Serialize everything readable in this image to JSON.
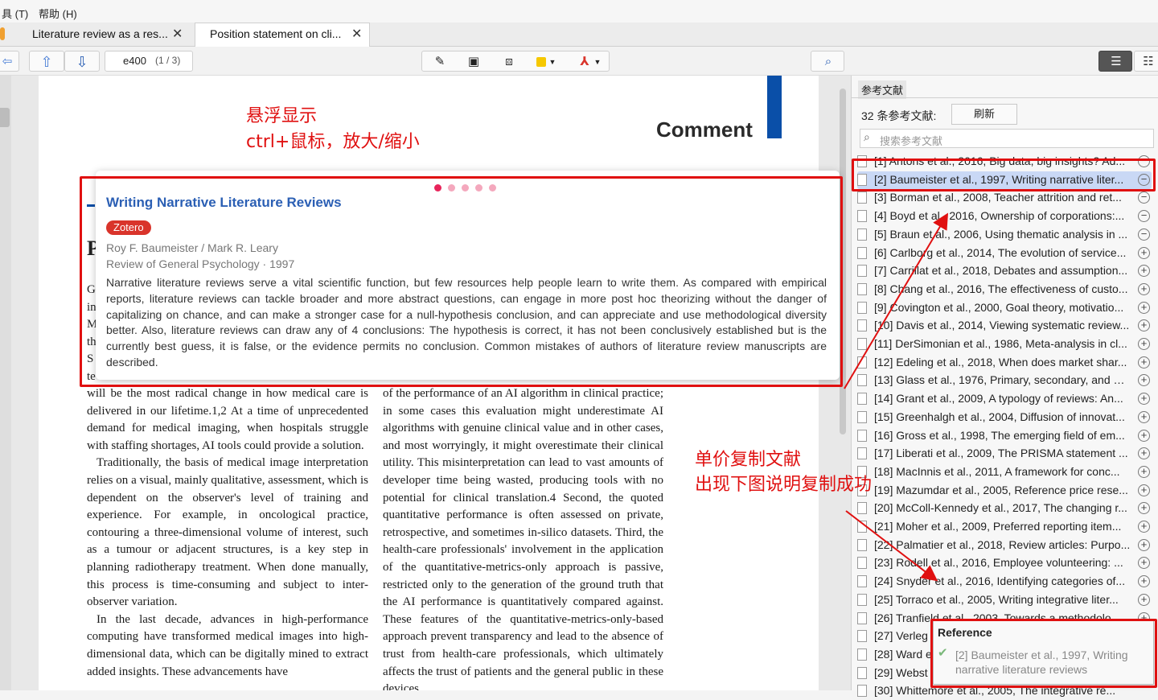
{
  "menu": {
    "tools": "具 (T)",
    "help": "帮助 (H)"
  },
  "tabs": [
    {
      "label": "Literature review as a res..."
    },
    {
      "label": "Position statement on cli..."
    }
  ],
  "toolbar": {
    "page_input": "e400",
    "page_count": "(1 / 3)"
  },
  "page": {
    "comment_heading": "Comment",
    "fragment_letters": [
      "P",
      "G",
      "in",
      "M",
      "th",
      "S",
      "te"
    ],
    "left_column": [
      "will be the most radical change in how medical care is delivered in our lifetime.1,2 At a time of unprecedented demand for medical imaging, when hospitals struggle with staffing shortages, AI tools could provide a solution.",
      "Traditionally, the basis of medical image interpretation relies on a visual, mainly qualitative, assessment, which is dependent on the observer's level of training and experience. For example, in oncological practice, contouring a three-dimensional volume of interest, such as a tumour or adjacent structures, is a key step in planning radiotherapy treatment. When done manually, this process is time-consuming and subject to inter-observer variation.",
      "In the last decade, advances in high-performance computing have transformed medical images into high-dimensional data, which can be digitally mined to extract added insights. These advancements have"
    ],
    "right_column": [
      "of the performance of an AI algorithm in clinical practice; in some cases this evaluation might underestimate AI algorithms with genuine clinical value and in other cases, and most worryingly, it might overestimate their clinical utility. This misinterpretation can lead to vast amounts of developer time being wasted, producing tools with no potential for clinical translation.4 Second, the quoted quantitative performance is often assessed on private, retrospective, and sometimes in-silico datasets. Third, the health-care professionals' involvement in the application of the quantitative-metrics-only approach is passive, restricted only to the generation of the ground truth that the AI performance is quantitatively compared against. These features of the quantitative-metrics-only-based approach prevent transparency and lead to the absence of trust from health-care professionals, which ultimately affects the trust of patients and the general public in these devices."
    ]
  },
  "popup": {
    "title": "Writing Narrative Literature Reviews",
    "badge": "Zotero",
    "authors": "Roy F. Baumeister / Mark R. Leary",
    "journal": "Review of General Psychology · 1997",
    "abstract": "Narrative literature reviews serve a vital scientific function, but few resources help people learn to write them. As compared with empirical reports, literature reviews can tackle broader and more abstract questions, can engage in more post hoc theorizing without the danger of capitalizing on chance, and can make a stronger case for a null-hypothesis conclusion, and can appreciate and use methodological diversity better. Also, literature reviews can draw any of 4 conclusions: The hypothesis is correct, it has not been conclusively established but is the currently best guess, it is false, or the evidence permits no conclusion. Common mistakes of authors of literature review manuscripts are described."
  },
  "annotations": {
    "hover_note": "悬浮显示",
    "zoom_note": "ctrl+鼠标，放大/缩小",
    "copy_note_1": "单价复制文献",
    "copy_note_2": "出现下图说明复制成功"
  },
  "panel": {
    "tab_label": "参考文献",
    "count_label": "32 条参考文献:",
    "refresh_label": "刷新",
    "search_placeholder": "搜索参考文献",
    "references": [
      {
        "text": "[1] Antons et al., 2016, Big data, big insights? Ad...",
        "sign": "−"
      },
      {
        "text": "[2] Baumeister et al., 1997, Writing narrative liter...",
        "sign": "−"
      },
      {
        "text": "[3] Borman et al., 2008, Teacher attrition and ret...",
        "sign": "−"
      },
      {
        "text": "[4] Boyd et al., 2016, Ownership of corporations:...",
        "sign": "−"
      },
      {
        "text": "[5] Braun et al., 2006, Using thematic analysis in ...",
        "sign": "−"
      },
      {
        "text": "[6] Carlborg et al., 2014, The evolution of service...",
        "sign": "+"
      },
      {
        "text": "[7] Carrillat et al., 2018, Debates and assumption...",
        "sign": "+"
      },
      {
        "text": "[8] Chang et al., 2016, The effectiveness of custo...",
        "sign": "+"
      },
      {
        "text": "[9] Covington et al., 2000, Goal theory, motivatio...",
        "sign": "+"
      },
      {
        "text": "[10] Davis et al., 2014, Viewing systematic review...",
        "sign": "+"
      },
      {
        "text": "[11] DerSimonian et al., 1986, Meta-analysis in cl...",
        "sign": "+"
      },
      {
        "text": "[12] Edeling et al., 2018, When does market shar...",
        "sign": "+"
      },
      {
        "text": "[13] Glass et al., 1976, Primary, secondary, and m...",
        "sign": "+"
      },
      {
        "text": "[14] Grant et al., 2009, A typology of reviews: An...",
        "sign": "+"
      },
      {
        "text": "[15] Greenhalgh et al., 2004, Diffusion of innovat...",
        "sign": "+"
      },
      {
        "text": "[16] Gross et al., 1998, The emerging field of em...",
        "sign": "+"
      },
      {
        "text": "[17] Liberati et al., 2009, The PRISMA statement ...",
        "sign": "+"
      },
      {
        "text": "[18] MacInnis et al., 2011, A framework for conc...",
        "sign": "+"
      },
      {
        "text": "[19] Mazumdar et al., 2005, Reference price rese...",
        "sign": "+"
      },
      {
        "text": "[20] McColl-Kennedy et al., 2017, The changing r...",
        "sign": "+"
      },
      {
        "text": "[21] Moher et al., 2009, Preferred reporting item...",
        "sign": "+"
      },
      {
        "text": "[22] Palmatier et al., 2018, Review articles: Purpo...",
        "sign": "+"
      },
      {
        "text": "[23] Rodell et al., 2016, Employee volunteering: ...",
        "sign": "+"
      },
      {
        "text": "[24] Snyder et al., 2016, Identifying categories of...",
        "sign": "+"
      },
      {
        "text": "[25] Torraco et al., 2005, Writing integrative liter...",
        "sign": "+"
      },
      {
        "text": "[26] Tranfield et al., 2003, Towards a methodolo...",
        "sign": "+"
      },
      {
        "text": "[27] Verleg",
        "sign": ""
      },
      {
        "text": "[28] Ward e",
        "sign": ""
      },
      {
        "text": "[29] Webst",
        "sign": ""
      },
      {
        "text": "[30] Whittemore et al., 2005, The integrative re...",
        "sign": ""
      }
    ]
  },
  "toast": {
    "title": "Reference",
    "message": "[2] Baumeister et al., 1997, Writing narrative literature reviews"
  },
  "colors": {
    "accent": "#2b5fb4",
    "annotation": "#e01010",
    "badge": "#d9342b",
    "highlight": "#c9d8f5"
  }
}
